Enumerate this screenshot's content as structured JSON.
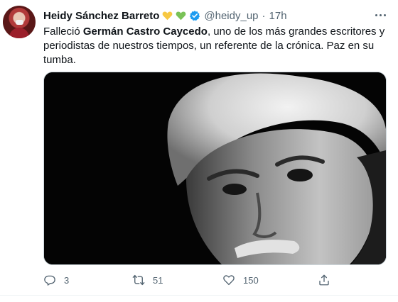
{
  "tweet": {
    "author_name": "Heidy Sánchez Barreto",
    "handle": "@heidy_up",
    "separator": "·",
    "time": "17h",
    "text_before": "Falleció ",
    "text_bold": "Germán Castro Caycedo",
    "text_after": ", uno de los más grandes escritores y periodistas de nuestros tiempos, un referente de la crónica. Paz en su tumba.",
    "emojis": [
      "yellow-heart",
      "green-heart"
    ],
    "verified": true
  },
  "actions": {
    "replies": "3",
    "retweets": "51",
    "likes": "150"
  },
  "colors": {
    "verified_blue": "#1d9bf0",
    "secondary_text": "#536471",
    "yellow_heart": "#f7c843",
    "green_heart": "#79c257"
  }
}
